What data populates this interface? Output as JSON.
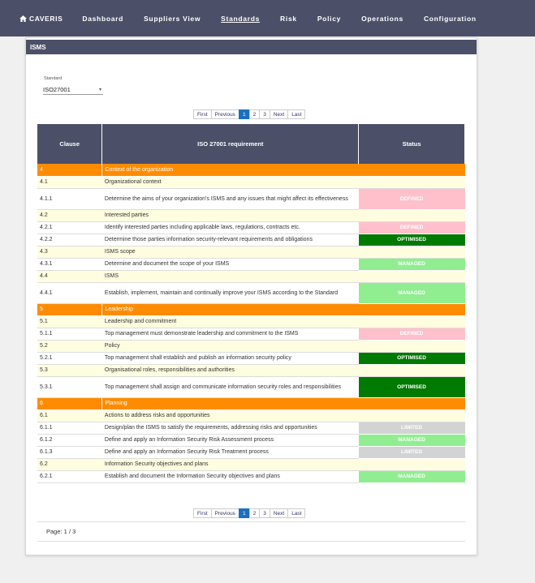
{
  "nav": {
    "brand": "CAVERIS",
    "items": [
      "Dashboard",
      "Suppliers View",
      "Standards",
      "Risk",
      "Policy",
      "Operations",
      "Configuration"
    ],
    "active": "Standards"
  },
  "panel": {
    "title": "ISMS"
  },
  "standard": {
    "label": "Standard",
    "value": "ISO27001"
  },
  "pagination": {
    "first": "First",
    "previous": "Previous",
    "pages": [
      "1",
      "2",
      "3"
    ],
    "current": "1",
    "next": "Next",
    "last": "Last"
  },
  "table": {
    "headers": [
      "Clause",
      "ISO 27001 requirement",
      "Status"
    ],
    "rows": [
      {
        "type": "section",
        "clause": "4",
        "requirement": "Context of the organization",
        "status": ""
      },
      {
        "type": "sub",
        "clause": "4.1",
        "requirement": "Organizational context",
        "status": ""
      },
      {
        "type": "req",
        "clause": "4.1.1",
        "requirement": "Determine the aims of your organization's ISMS and any issues that might affect its effectiveness",
        "status": "DEFINED"
      },
      {
        "type": "sub",
        "clause": "4.2",
        "requirement": "Interested parties",
        "status": ""
      },
      {
        "type": "req",
        "clause": "4.2.1",
        "requirement": "Identify interested parties including applicable laws, regulations, contracts etc.",
        "status": "DEFINED"
      },
      {
        "type": "req",
        "clause": "4.2.2",
        "requirement": "Determine those parties information security-relevant requirements and obligations",
        "status": "OPTIMISED"
      },
      {
        "type": "sub",
        "clause": "4.3",
        "requirement": "ISMS scope",
        "status": ""
      },
      {
        "type": "req",
        "clause": "4.3.1",
        "requirement": "Determine and document the scope of your ISMS",
        "status": "MANAGED"
      },
      {
        "type": "sub",
        "clause": "4.4",
        "requirement": "ISMS",
        "status": ""
      },
      {
        "type": "req",
        "clause": "4.4.1",
        "requirement": "Establish, implement, maintain and continually improve your ISMS according to the Standard",
        "status": "MANAGED"
      },
      {
        "type": "section",
        "clause": "5",
        "requirement": "Leadership",
        "status": ""
      },
      {
        "type": "sub",
        "clause": "5.1",
        "requirement": "Leadership and commitment",
        "status": ""
      },
      {
        "type": "req",
        "clause": "5.1.1",
        "requirement": "Top management must demonstrate leadership and commitment to the ISMS",
        "status": "DEFINED"
      },
      {
        "type": "sub",
        "clause": "5.2",
        "requirement": "Policy",
        "status": ""
      },
      {
        "type": "req",
        "clause": "5.2.1",
        "requirement": "Top management shall establish and publish an information security policy",
        "status": "OPTIMISED"
      },
      {
        "type": "sub",
        "clause": "5.3",
        "requirement": "Organisational roles, responsibilities and authorities",
        "status": ""
      },
      {
        "type": "req",
        "clause": "5.3.1",
        "requirement": "Top management shall assign and communicate information security roles and responsibilities",
        "status": "OPTIMISED"
      },
      {
        "type": "section",
        "clause": "6",
        "requirement": "Planning",
        "status": ""
      },
      {
        "type": "sub",
        "clause": "6.1",
        "requirement": "Actions to address risks and opportunities",
        "status": ""
      },
      {
        "type": "req",
        "clause": "6.1.1",
        "requirement": "Design/plan the ISMS to satisfy the requirements, addressing risks and opportunities",
        "status": "LIMITED"
      },
      {
        "type": "req",
        "clause": "6.1.2",
        "requirement": "Define and apply an Information Security Risk Assessment process",
        "status": "MANAGED"
      },
      {
        "type": "req",
        "clause": "6.1.3",
        "requirement": "Define and apply an Information Security Risk Treatment process",
        "status": "LIMITED"
      },
      {
        "type": "sub",
        "clause": "6.2",
        "requirement": "Information Security objectives and plans",
        "status": ""
      },
      {
        "type": "req",
        "clause": "6.2.1",
        "requirement": "Establish and document the Information Security objectives and plans",
        "status": "MANAGED"
      }
    ]
  },
  "status_colors": {
    "DEFINED": "#ffc0cb",
    "OPTIMISED": "#007a00",
    "MANAGED": "#90ee90",
    "LIMITED": "#d3d3d3"
  },
  "page_info": "Page: 1 / 3"
}
